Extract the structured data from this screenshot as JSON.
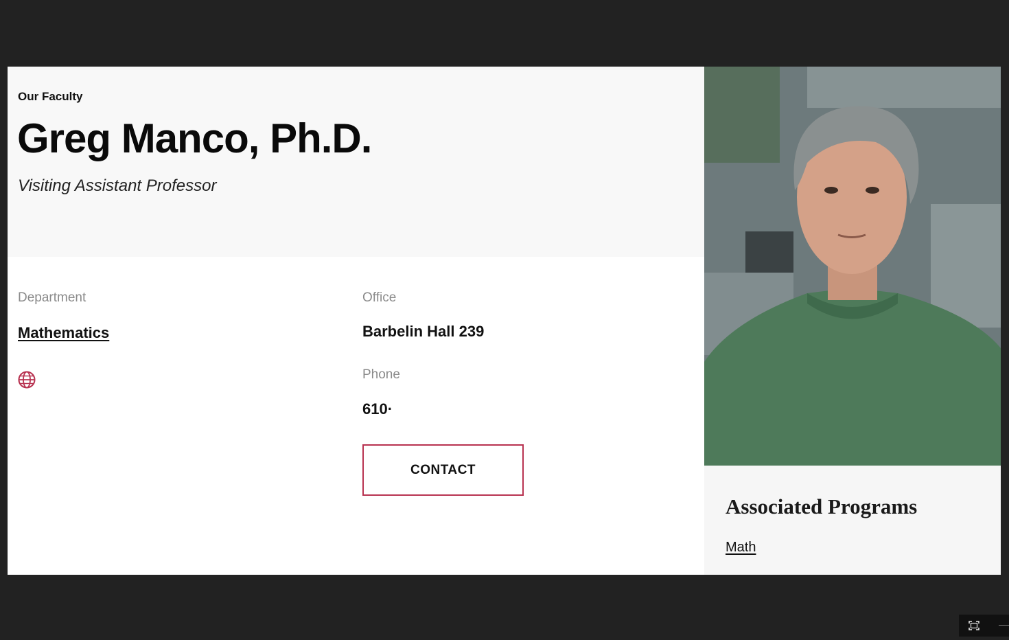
{
  "profile": {
    "eyebrow": "Our Faculty",
    "name": "Greg Manco, Ph.D.",
    "title": "Visiting Assistant Professor"
  },
  "department": {
    "label": "Department",
    "value": "Mathematics"
  },
  "website": {
    "icon": "globe-icon"
  },
  "office": {
    "label": "Office",
    "value": "Barbelin Hall 239"
  },
  "phone": {
    "label": "Phone",
    "value": "610·"
  },
  "contact": {
    "label": "CONTACT"
  },
  "programs": {
    "title": "Associated Programs",
    "items": [
      "Math"
    ]
  },
  "colors": {
    "accent": "#b83250",
    "page_bg": "#222222",
    "hero_bg": "#f8f8f8"
  },
  "controls": {
    "fullscreen_icon": "fullscreen-icon"
  }
}
